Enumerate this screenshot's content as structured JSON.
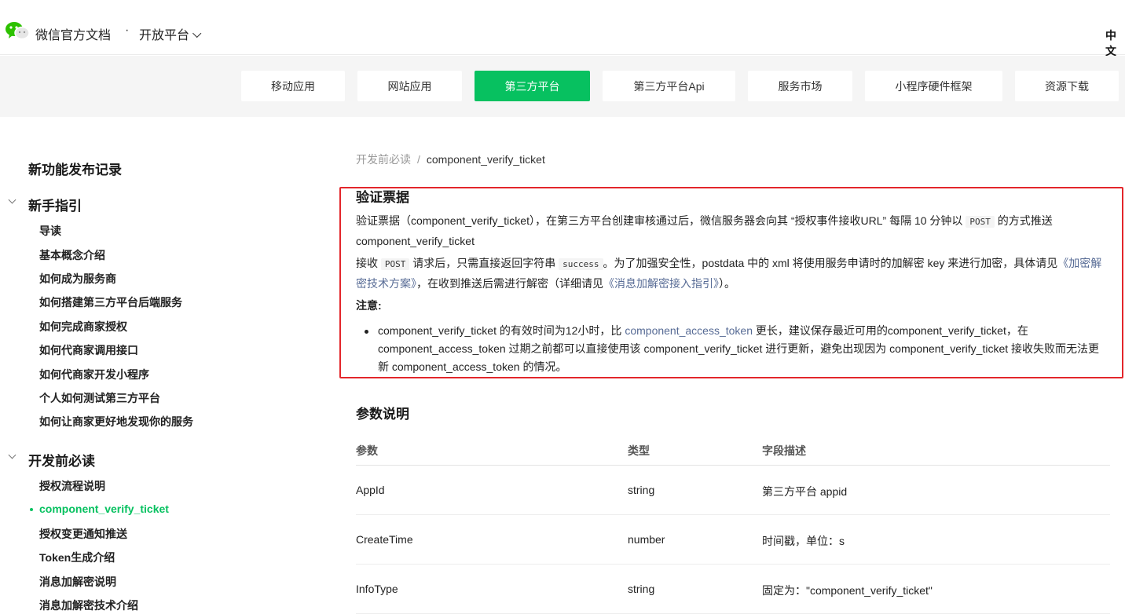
{
  "header": {
    "site_title": "微信官方文档",
    "separator": "·",
    "platform": "开放平台",
    "lang": "中文"
  },
  "nav": {
    "tabs": [
      {
        "label": "移动应用"
      },
      {
        "label": "网站应用"
      },
      {
        "label": "第三方平台",
        "active": true
      },
      {
        "label": "第三方平台Api"
      },
      {
        "label": "服务市场"
      },
      {
        "label": "小程序硬件框架"
      },
      {
        "label": "资源下载"
      }
    ]
  },
  "sidebar": {
    "top_item": "新功能发布记录",
    "group1": {
      "title": "新手指引",
      "items": [
        "导读",
        "基本概念介绍",
        "如何成为服务商",
        "如何搭建第三方平台后端服务",
        "如何完成商家授权",
        "如何代商家调用接口",
        "如何代商家开发小程序",
        "个人如何测试第三方平台",
        "如何让商家更好地发现你的服务"
      ]
    },
    "group2": {
      "title": "开发前必读",
      "items": [
        "授权流程说明",
        "component_verify_ticket",
        "授权变更通知推送",
        "Token生成介绍",
        "消息加解密说明",
        "消息加解密技术介绍"
      ]
    }
  },
  "breadcrumb": {
    "parent": "开发前必读",
    "sep": "/",
    "current": "component_verify_ticket"
  },
  "section1": {
    "title": "验证票据",
    "p1_a": "验证票据（component_verify_ticket），在第三方平台创建审核通过后，微信服务器会向其 “授权事件接收URL” 每隔 10 分钟以",
    "p1_code": "POST",
    "p1_b": "的方式推送 component_verify_ticket",
    "p2_a": "接收",
    "p2_code1": "POST",
    "p2_b": "请求后，只需直接返回字符串",
    "p2_code2": "success",
    "p2_c": "。为了加强安全性，postdata 中的 xml 将使用服务申请时的加解密 key 来进行加密，具体请见",
    "p2_link1": "《加密解密技术方案》",
    "p2_d": "，在收到推送后需进行解密（详细请见",
    "p2_link2": "《消息加解密接入指引》",
    "p2_e": "）。",
    "note": "注意:",
    "bullet_a": "component_verify_ticket 的有效时间为12小时，比",
    "bullet_link": "component_access_token",
    "bullet_b": "更长，建议保存最近可用的component_verify_ticket，在 component_access_token 过期之前都可以直接使用该 component_verify_ticket 进行更新，避免出现因为 component_verify_ticket 接收失败而无法更新 component_access_token 的情况。"
  },
  "section2": {
    "title": "参数说明",
    "headers": [
      "参数",
      "类型",
      "字段描述"
    ],
    "rows": [
      [
        "AppId",
        "string",
        "第三方平台 appid"
      ],
      [
        "CreateTime",
        "number",
        "时间戳，单位：s"
      ],
      [
        "InfoType",
        "string",
        "固定为：\"component_verify_ticket\""
      ]
    ]
  },
  "colors": {
    "brand_green": "#07c160",
    "link": "#576b95",
    "highlight_border": "#e3262b"
  }
}
